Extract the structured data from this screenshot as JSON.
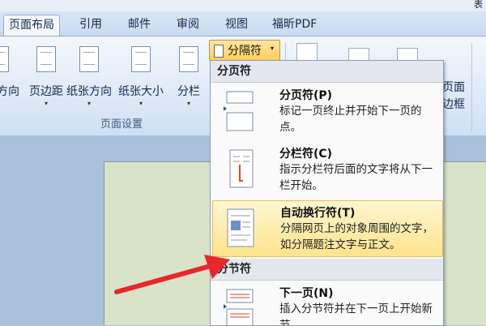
{
  "title_fragment": "表",
  "tabs": [
    {
      "label": "页面布局",
      "active": true
    },
    {
      "label": "引用",
      "active": false
    },
    {
      "label": "邮件",
      "active": false
    },
    {
      "label": "审阅",
      "active": false
    },
    {
      "label": "视图",
      "active": false
    },
    {
      "label": "福昕PDF",
      "active": false
    }
  ],
  "ribbon": {
    "buttons": [
      {
        "label": "方向"
      },
      {
        "label": "页边距"
      },
      {
        "label": "纸张方向"
      },
      {
        "label": "纸张大小"
      },
      {
        "label": "分栏"
      }
    ],
    "group_label": "页面设置",
    "breaks_button": "分隔符",
    "right_labels": [
      "页面",
      "边框"
    ]
  },
  "menu": {
    "page_breaks_header": "分页符",
    "items": [
      {
        "title": "分页符(P)",
        "desc": "标记一页终止并开始下一页的点。"
      },
      {
        "title": "分栏符(C)",
        "desc": "指示分栏符后面的文字将从下一栏开始。"
      },
      {
        "title": "自动换行符(T)",
        "desc": "分隔网页上的对象周围的文字，如分隔题注文字与正文。",
        "highlighted": true
      }
    ],
    "section_breaks_header": "分节符",
    "section_items": [
      {
        "title": "下一页(N)",
        "desc": "插入分节符并在下一页上开始新节。"
      }
    ]
  },
  "colors": {
    "highlight": "#ffe48c",
    "arrow": "#e8262b",
    "ribbon": "#dbe6f4"
  }
}
